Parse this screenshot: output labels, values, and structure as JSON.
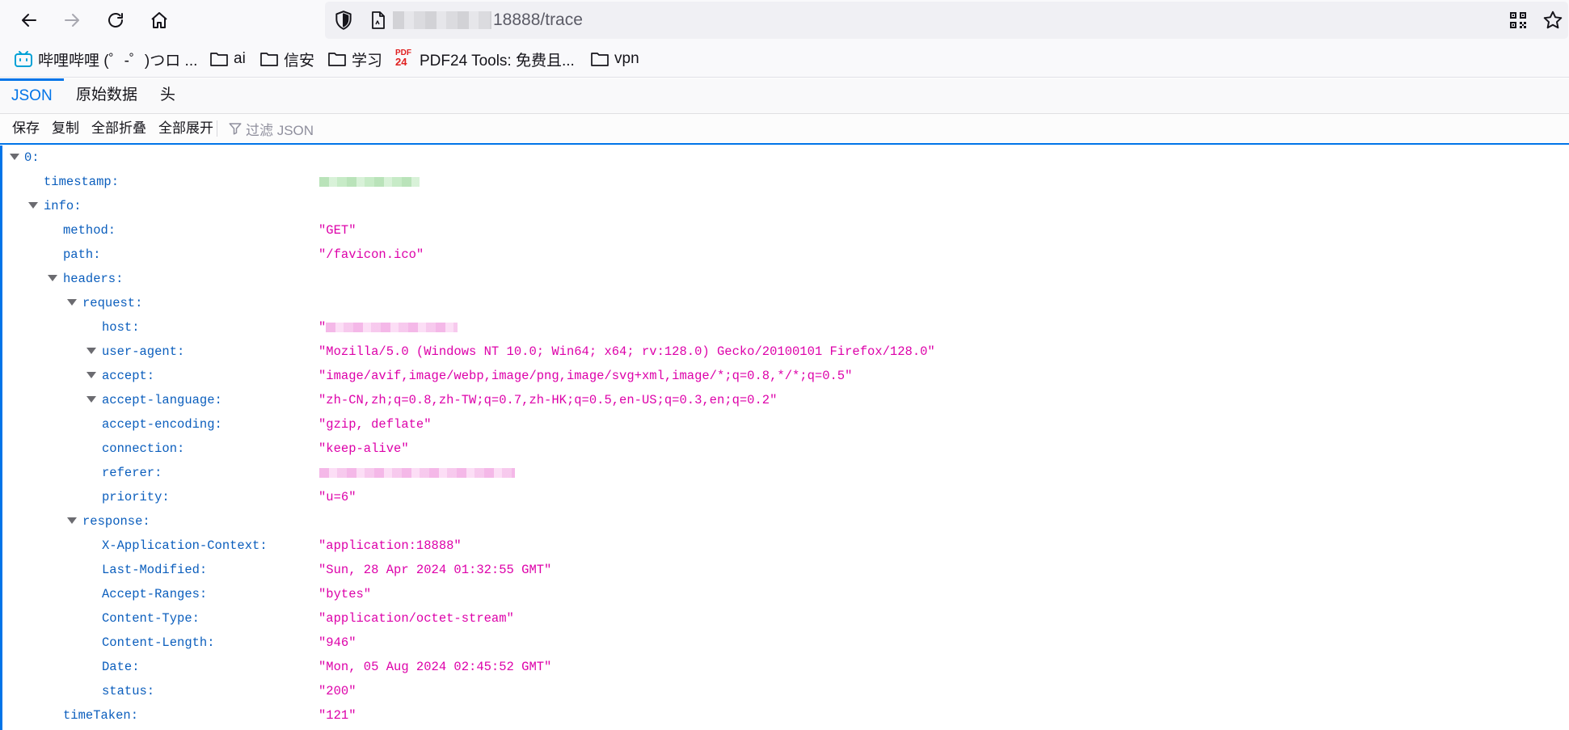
{
  "browser": {
    "url_suffix": "18888/trace",
    "bookmarks": [
      {
        "label": "哔哩哔哩 (゜-゜)つロ ...",
        "icon": "bilibili-icon"
      },
      {
        "label": "ai",
        "icon": "folder-icon"
      },
      {
        "label": "信安",
        "icon": "folder-icon"
      },
      {
        "label": "学习",
        "icon": "folder-icon"
      },
      {
        "label": "PDF24 Tools: 免费且...",
        "icon": "pdf24-icon"
      },
      {
        "label": "vpn",
        "icon": "folder-icon"
      }
    ],
    "pdf_icon_top": "PDF",
    "pdf_icon_bottom": "24"
  },
  "viewer": {
    "tabs": [
      "JSON",
      "原始数据",
      "头"
    ],
    "active_tab": "JSON",
    "toolbar": {
      "save": "保存",
      "copy": "复制",
      "collapse_all": "全部折叠",
      "expand_all": "全部展开",
      "filter_placeholder": "过滤 JSON"
    },
    "accent": "#0074e8",
    "key_color": "#0b5ebd",
    "string_color": "#dd00a9"
  },
  "json": {
    "index_key": "0:",
    "timestamp_key": "timestamp:",
    "info_key": "info:",
    "method_key": "method:",
    "method": "\"GET\"",
    "path_key": "path:",
    "path": "\"/favicon.ico\"",
    "headers_key": "headers:",
    "request_key": "request:",
    "request": {
      "host_key": "host:",
      "host_prefix": "\"",
      "user_agent_key": "user-agent:",
      "user_agent": "\"Mozilla/5.0 (Windows NT 10.0; Win64; x64; rv:128.0) Gecko/20100101 Firefox/128.0\"",
      "accept_key": "accept:",
      "accept": "\"image/avif,image/webp,image/png,image/svg+xml,image/*;q=0.8,*/*;q=0.5\"",
      "accept_language_key": "accept-language:",
      "accept_language": "\"zh-CN,zh;q=0.8,zh-TW;q=0.7,zh-HK;q=0.5,en-US;q=0.3,en;q=0.2\"",
      "accept_encoding_key": "accept-encoding:",
      "accept_encoding": "\"gzip, deflate\"",
      "connection_key": "connection:",
      "connection": "\"keep-alive\"",
      "referer_key": "referer:",
      "priority_key": "priority:",
      "priority": "\"u=6\""
    },
    "response_key": "response:",
    "response": {
      "x_app_context_key": "X-Application-Context:",
      "x_app_context": "\"application:18888\"",
      "last_modified_key": "Last-Modified:",
      "last_modified": "\"Sun, 28 Apr 2024 01:32:55 GMT\"",
      "accept_ranges_key": "Accept-Ranges:",
      "accept_ranges": "\"bytes\"",
      "content_type_key": "Content-Type:",
      "content_type": "\"application/octet-stream\"",
      "content_length_key": "Content-Length:",
      "content_length": "\"946\"",
      "date_key": "Date:",
      "date": "\"Mon, 05 Aug 2024 02:45:52 GMT\"",
      "status_key": "status:",
      "status": "\"200\""
    },
    "time_taken_key": "timeTaken:",
    "time_taken": "\"121\""
  }
}
